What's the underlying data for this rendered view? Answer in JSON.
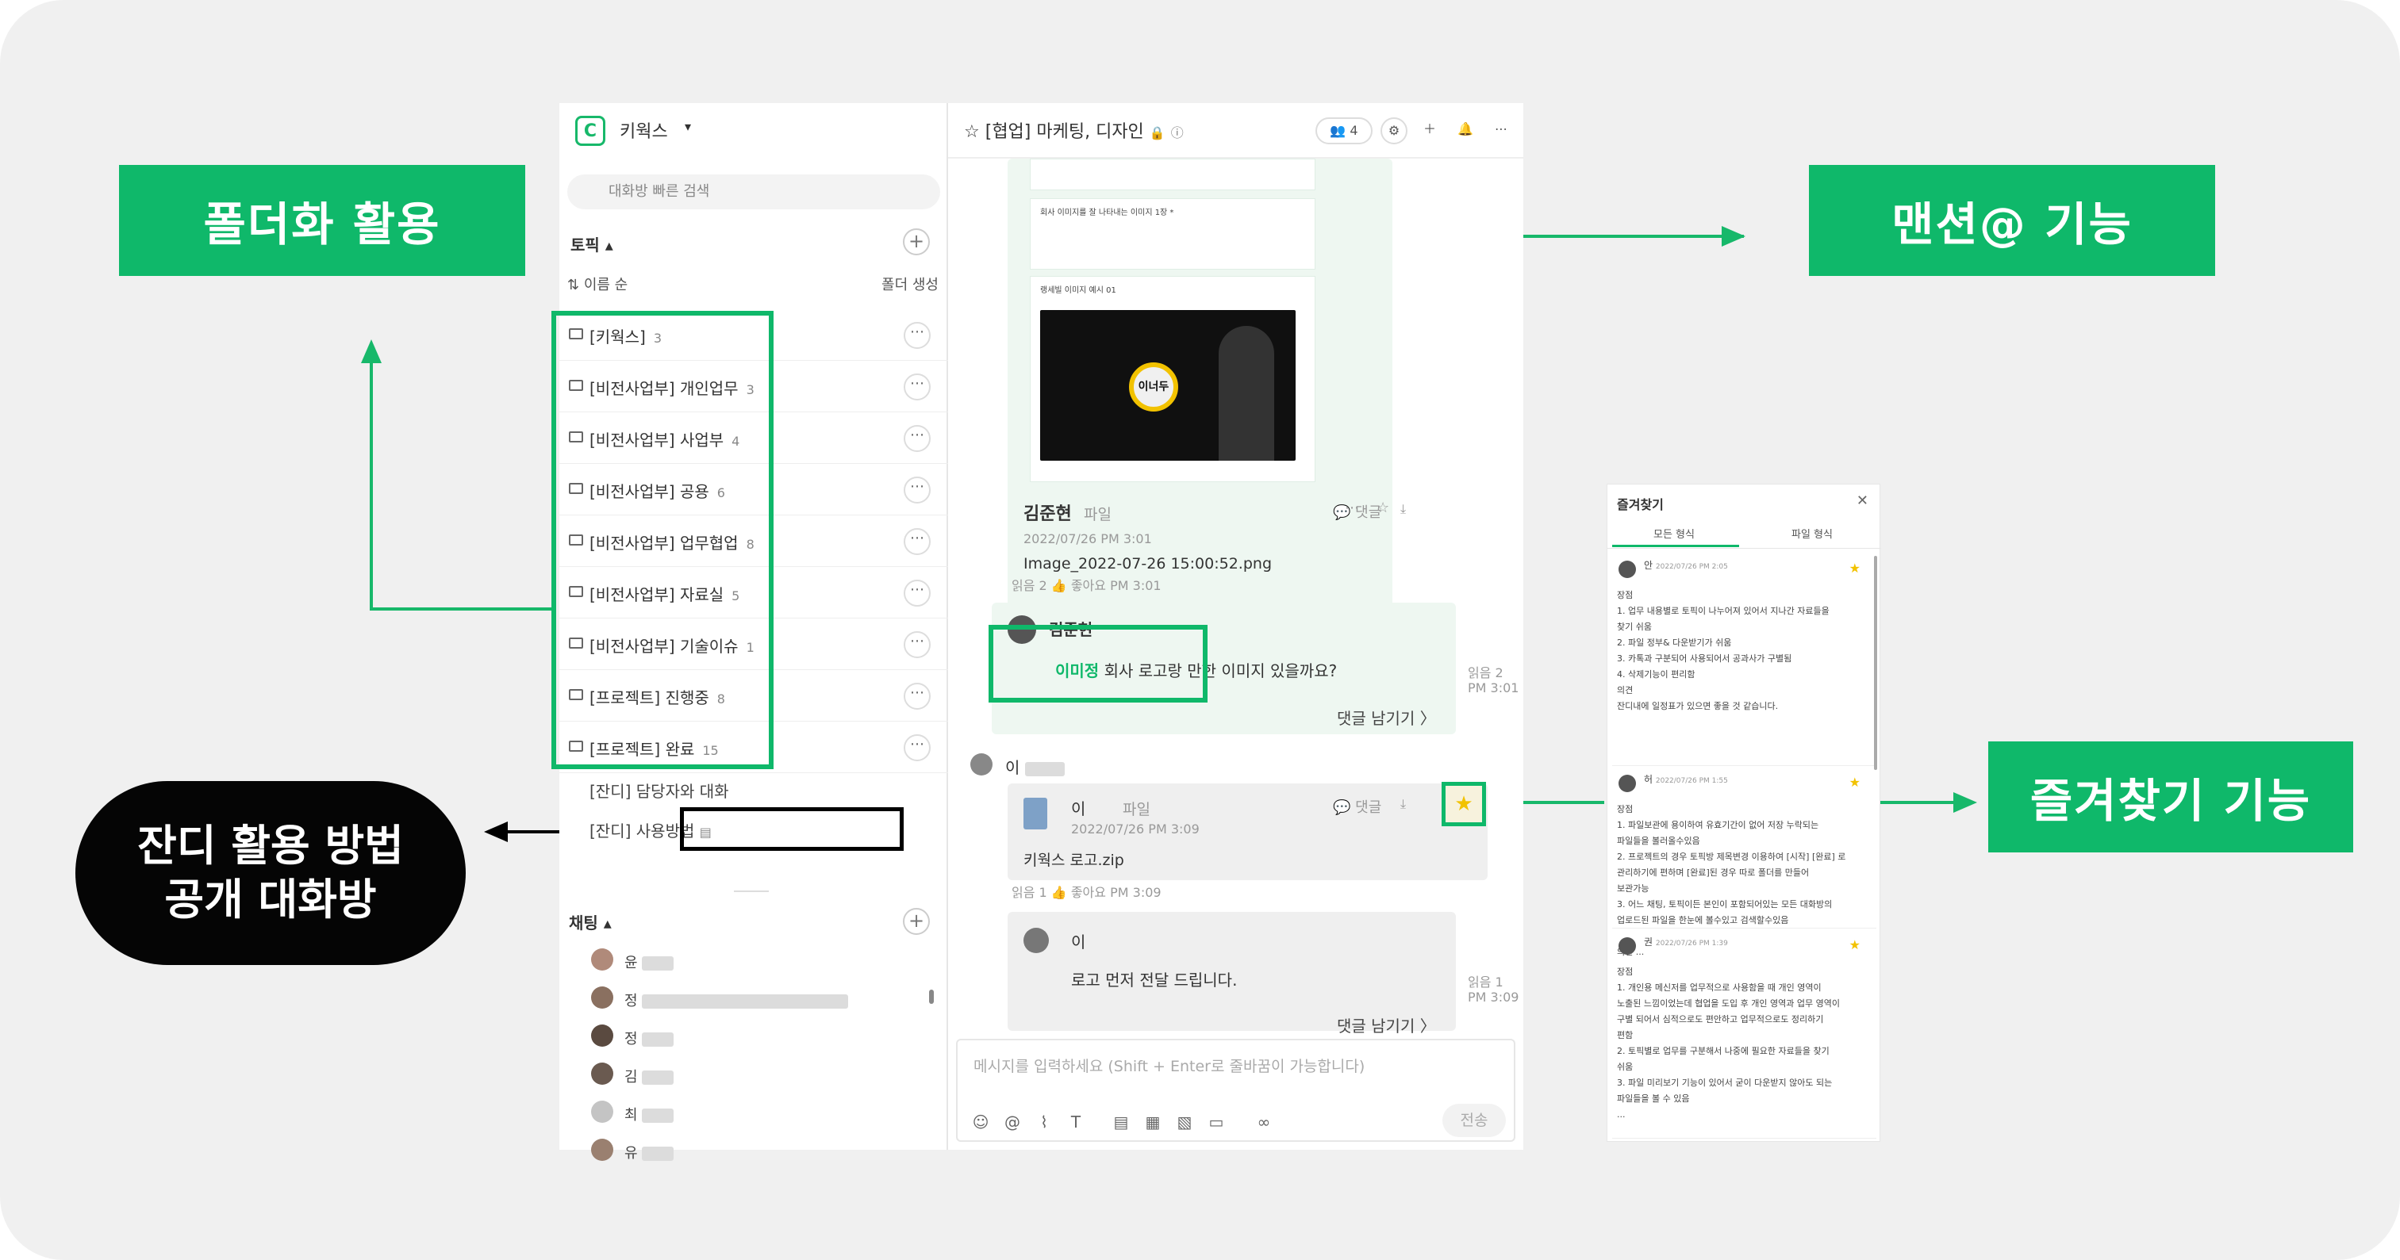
{
  "callouts": {
    "folder": "폴더화 활용",
    "mention": "맨션@ 기능",
    "favorite": "즐겨찾기 기능",
    "janddi_line1": "잔디 활용 방법",
    "janddi_line2": "공개 대화방"
  },
  "sidebar": {
    "logo_text": "C",
    "workspace_name": "키웍스",
    "search_placeholder": "대화방 빠른 검색",
    "topic_title": "토픽 ▴",
    "sort_label": "이름 순",
    "create_folder": "폴더 생성",
    "folders": [
      {
        "name": "[키웍스]",
        "count": "3"
      },
      {
        "name": "[비전사업부] 개인업무",
        "count": "3"
      },
      {
        "name": "[비전사업부] 사업부",
        "count": "4"
      },
      {
        "name": "[비전사업부] 공용",
        "count": "6"
      },
      {
        "name": "[비전사업부] 업무협업",
        "count": "8"
      },
      {
        "name": "[비전사업부] 자료실",
        "count": "5"
      },
      {
        "name": "[비전사업부] 기술이슈",
        "count": "1"
      },
      {
        "name": "[프로젝트] 진행중",
        "count": "8"
      },
      {
        "name": "[프로젝트] 완료",
        "count": "15"
      }
    ],
    "rooms": [
      "[잔디] 담당자와 대화",
      "[잔디] 사용방법"
    ],
    "chat_title": "채팅 ▴",
    "chats": [
      "윤",
      "정",
      "정",
      "김",
      "최",
      "유"
    ]
  },
  "chat": {
    "title": "[협업] 마케팅, 디자인",
    "member_count": "4",
    "image_caption_1": "회사 이미지를 잘 나타내는 이미지 1장 *",
    "image_caption_2": "랭세빌 이미지 예시 01",
    "image_logo_text": "이너두",
    "msg1": {
      "sender": "김준현",
      "type": "파일",
      "time": "2022/07/26 PM 3:01",
      "filename": "Image_2022-07-26 15:00:52.png",
      "read": "읽음 2",
      "like": "좋아요",
      "like_time": "PM 3:01",
      "comment": "댓글"
    },
    "msg2": {
      "sender": "김준현",
      "mention": "이미정",
      "text": "회사 로고랑 만한 이미지 있을까요?",
      "read": "읽음 2",
      "time": "PM 3:01",
      "leave_comment": "댓글 남기기 〉"
    },
    "sep_letter": "이",
    "msg3": {
      "sender": "이",
      "type": "파일",
      "time": "2022/07/26 PM 3:09",
      "filename": "키웍스 로고.zip",
      "read": "읽음 1",
      "like": "좋아요",
      "like_time": "PM 3:09",
      "comment": "댓글"
    },
    "msg4": {
      "sender": "이",
      "text": "로고 먼저 전달 드립니다.",
      "read": "읽음 1",
      "time": "PM 3:09",
      "leave_comment": "댓글 남기기 〉"
    },
    "input_placeholder": "메시지를 입력하세요 (Shift + Enter로 줄바꿈이 가능합니다)",
    "send_label": "전송"
  },
  "favorites": {
    "title": "즐겨찾기",
    "tabs": [
      "모든 형식",
      "파일 형식"
    ],
    "cards": [
      {
        "name": "안",
        "date": "2022/07/26 PM 2:05",
        "lines": [
          "장점",
          "1. 업무 내용별로 토픽이 나누어져 있어서 지나간 자료들을",
          "찾기 쉬움",
          "2. 파일 정부& 다운받기가 쉬움",
          "3. 카톡과 구분되어 사용되어서 공과사가 구별됨",
          "4. 삭제기능이 편리함",
          "의견",
          "잔디내에 일정표가 있으면 좋을 것 같습니다."
        ]
      },
      {
        "name": "허",
        "date": "2022/07/26 PM 1:55",
        "lines": [
          "장점",
          "1. 파일보관에 용이하여 유효기간이 없어 저장 누락되는",
          "파일들을 볼러올수있음",
          "2. 프로젝트의 경우 토픽방 제목변경 이용하여 [시작] [완료] 로",
          "관리하기에 편하며 [완료]된 경우 따로 폴더를 만들어",
          "보관가능",
          "3. 어느 채팅, 토픽이든 본인이 포함되어있는 모든 대화방의",
          "업로드된 파일을 한눈에 볼수있고 검색할수있음",
          "",
          "의견 ..."
        ]
      },
      {
        "name": "권",
        "date": "2022/07/26 PM 1:39",
        "lines": [
          "장점",
          "1. 개인용 메신저를 업무적으로 사용함을 때 개인 영역이",
          "노출된 느낌이었는데 협업을 도입 후 개인 영역과 업무 영역이",
          "구별 되어서 심적으로도 편안하고 업무적으로도 정리하기",
          "편함",
          "2. 토픽별로 업무를 구분해서 나중에 필요한 자료들을 찾기",
          "쉬움",
          "3. 파일 미리보기 기능이 있어서 굳이 다운받지 않아도 되는",
          "파일들을 볼 수 있음",
          "..."
        ]
      }
    ]
  },
  "colors": {
    "accent": "#0fb86a",
    "star": "#f2c200",
    "dark": "#050505"
  }
}
